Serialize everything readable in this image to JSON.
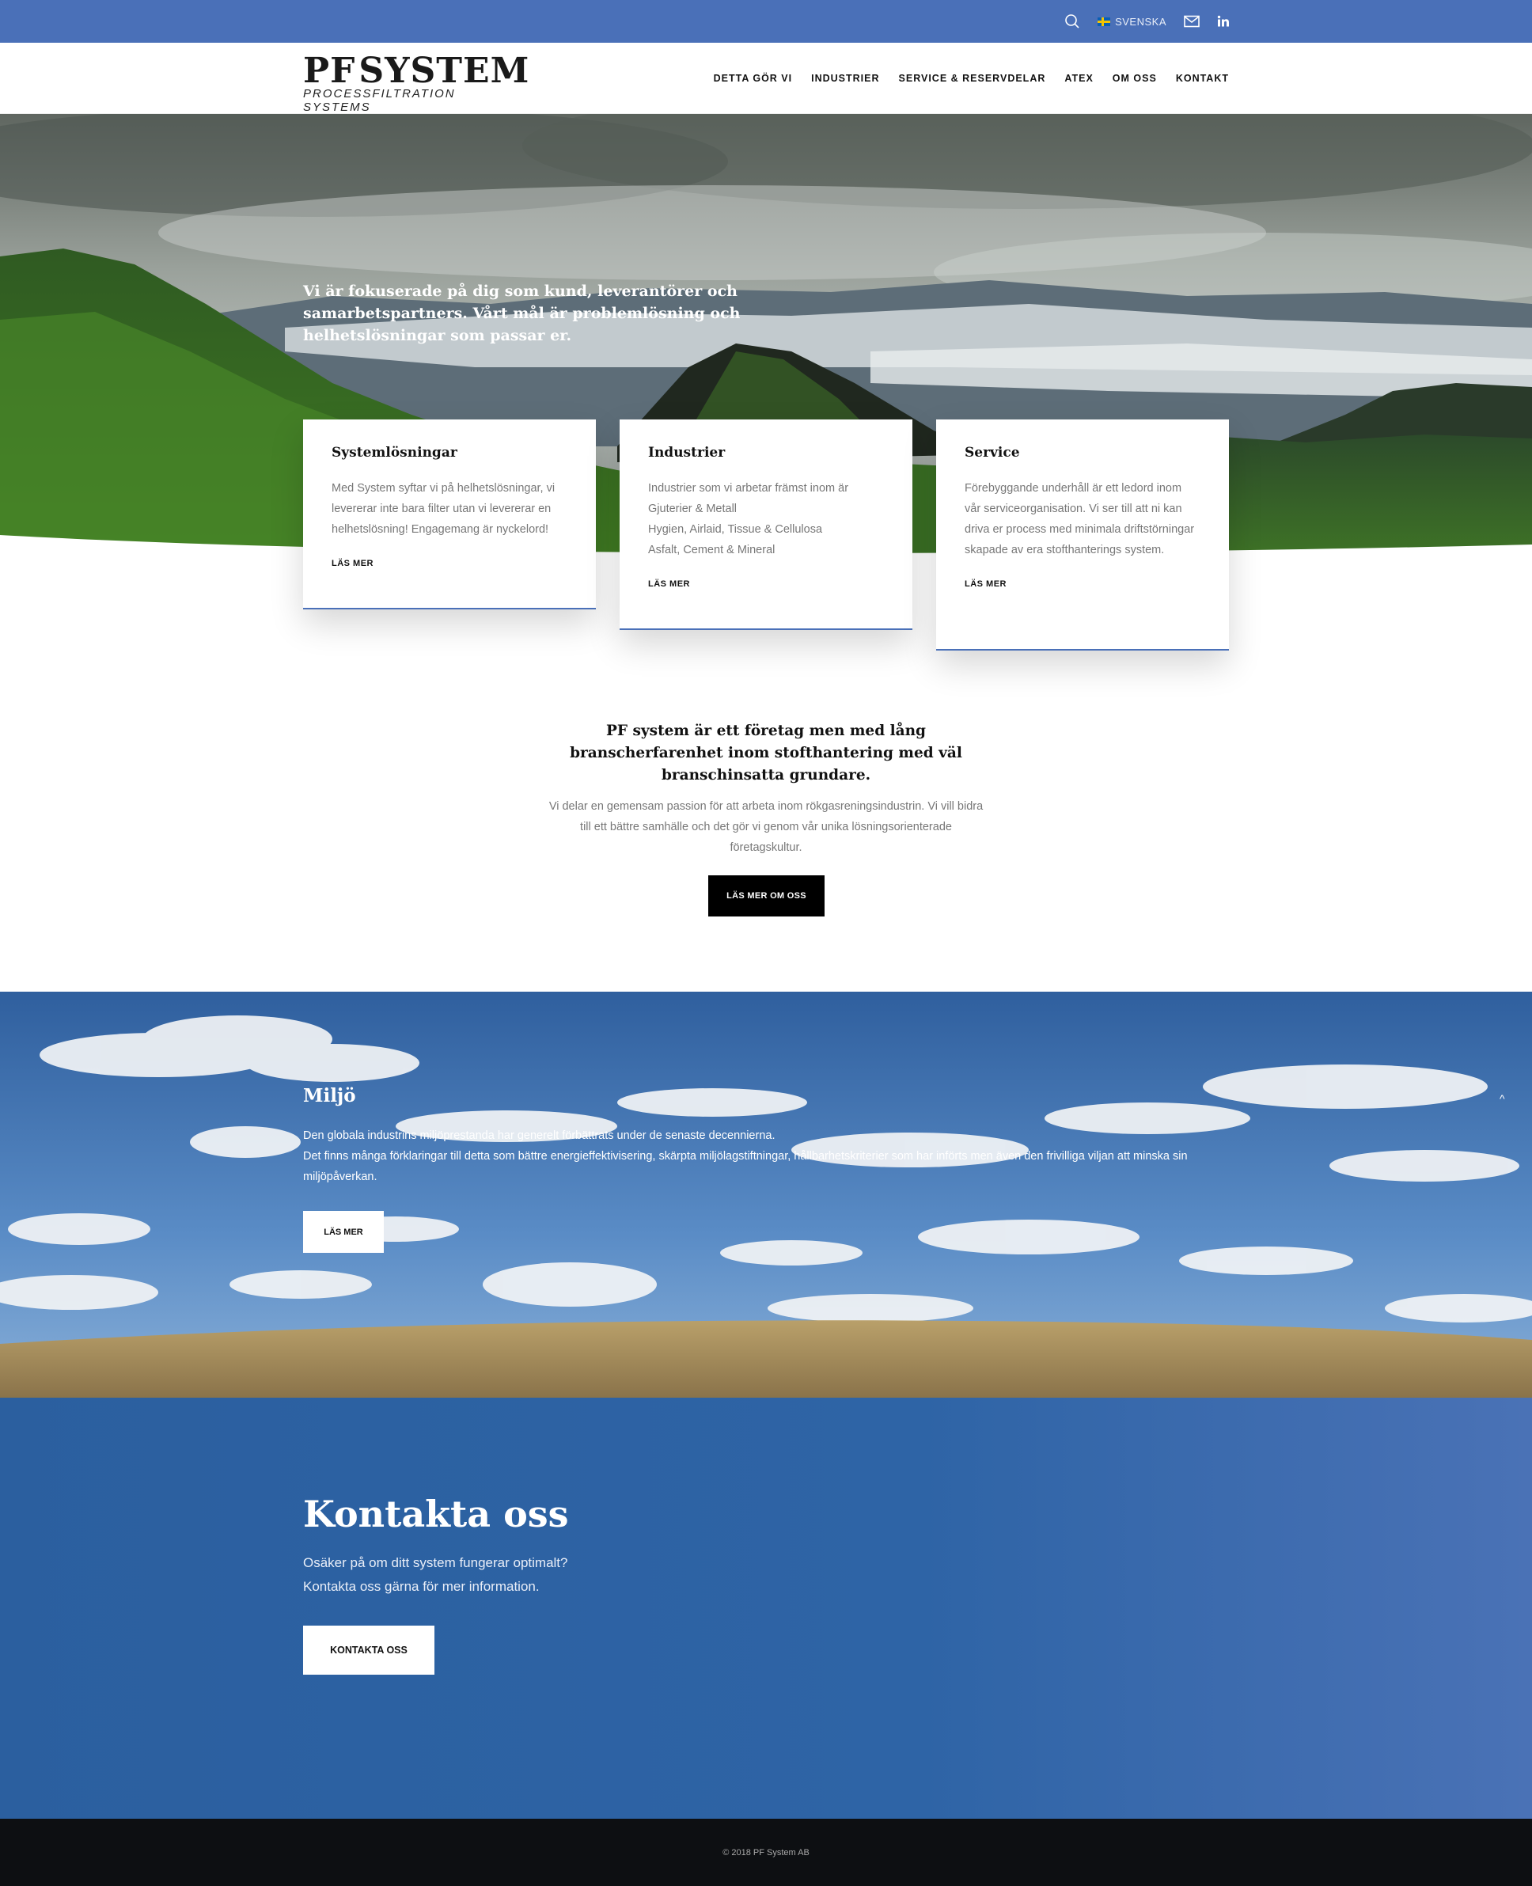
{
  "topbar": {
    "language": "SVENSKA",
    "icons": [
      "search-icon",
      "flag-icon",
      "mail-icon",
      "linkedin-icon"
    ]
  },
  "header": {
    "logo_main_left": "PF",
    "logo_main_right": "SYSTEM",
    "logo_sub": "PROCESSFILTRATION SYSTEMS",
    "nav": [
      "DETTA GÖR VI",
      "INDUSTRIER",
      "SERVICE & RESERVDELAR",
      "ATEX",
      "OM OSS",
      "KONTAKT"
    ]
  },
  "hero": {
    "text": "Vi är fokuserade på dig som kund, leverantörer och samarbetspartners. Vårt mål är problemlösning och helhetslösningar som passar er."
  },
  "cards": [
    {
      "title": "Systemlösningar",
      "lines": [
        "Med System syftar vi på helhetslösningar, vi levererar inte bara filter utan vi levererar en helhetslösning! Engagemang är nyckelord!"
      ],
      "more": "LÄS MER"
    },
    {
      "title": "Industrier",
      "lines": [
        "Industrier som vi arbetar främst inom är",
        "Gjuterier & Metall",
        "Hygien, Airlaid, Tissue & Cellulosa",
        "Asfalt, Cement & Mineral"
      ],
      "more": "LÄS MER"
    },
    {
      "title": "Service",
      "lines": [
        "Förebyggande underhåll är ett ledord inom vår serviceorganisation. Vi ser till att ni kan driva er process med minimala driftstörningar skapade av era stofthanterings system."
      ],
      "more": "LÄS MER"
    }
  ],
  "intro": {
    "title": "PF system är ett företag men med lång branscherfarenhet inom stofthantering med väl branschinsatta grundare.",
    "text": "Vi delar en gemensam passion för att arbeta inom rökgasreningsindustrin. Vi vill bidra till ett bättre samhälle och det gör vi genom vår unika lösningsorienterade företagskultur.",
    "button": "LÄS MER OM OSS"
  },
  "miljo": {
    "title": "Miljö",
    "line1": "Den globala industrins miljöprestanda har generelt förbättrats under de senaste decennierna.",
    "line2": "Det finns många förklaringar till detta som bättre energieffektivisering, skärpta miljölagstiftningar, hållbarhetskriterier som har införts men även den frivilliga viljan att minska sin miljöpåverkan.",
    "button": "LÄS MER",
    "scroll_up": "^"
  },
  "contact": {
    "title": "Kontakta oss",
    "line1": "Osäker på om ditt system fungerar optimalt?",
    "line2": "Kontakta oss gärna för mer information.",
    "button": "KONTAKTA OSS"
  },
  "footer": {
    "copyright": "© 2018 PF System AB"
  },
  "colors": {
    "brand_blue": "#4a70b8",
    "contact_blue": "#2e64a6",
    "footer_dark": "#0d0f12"
  }
}
